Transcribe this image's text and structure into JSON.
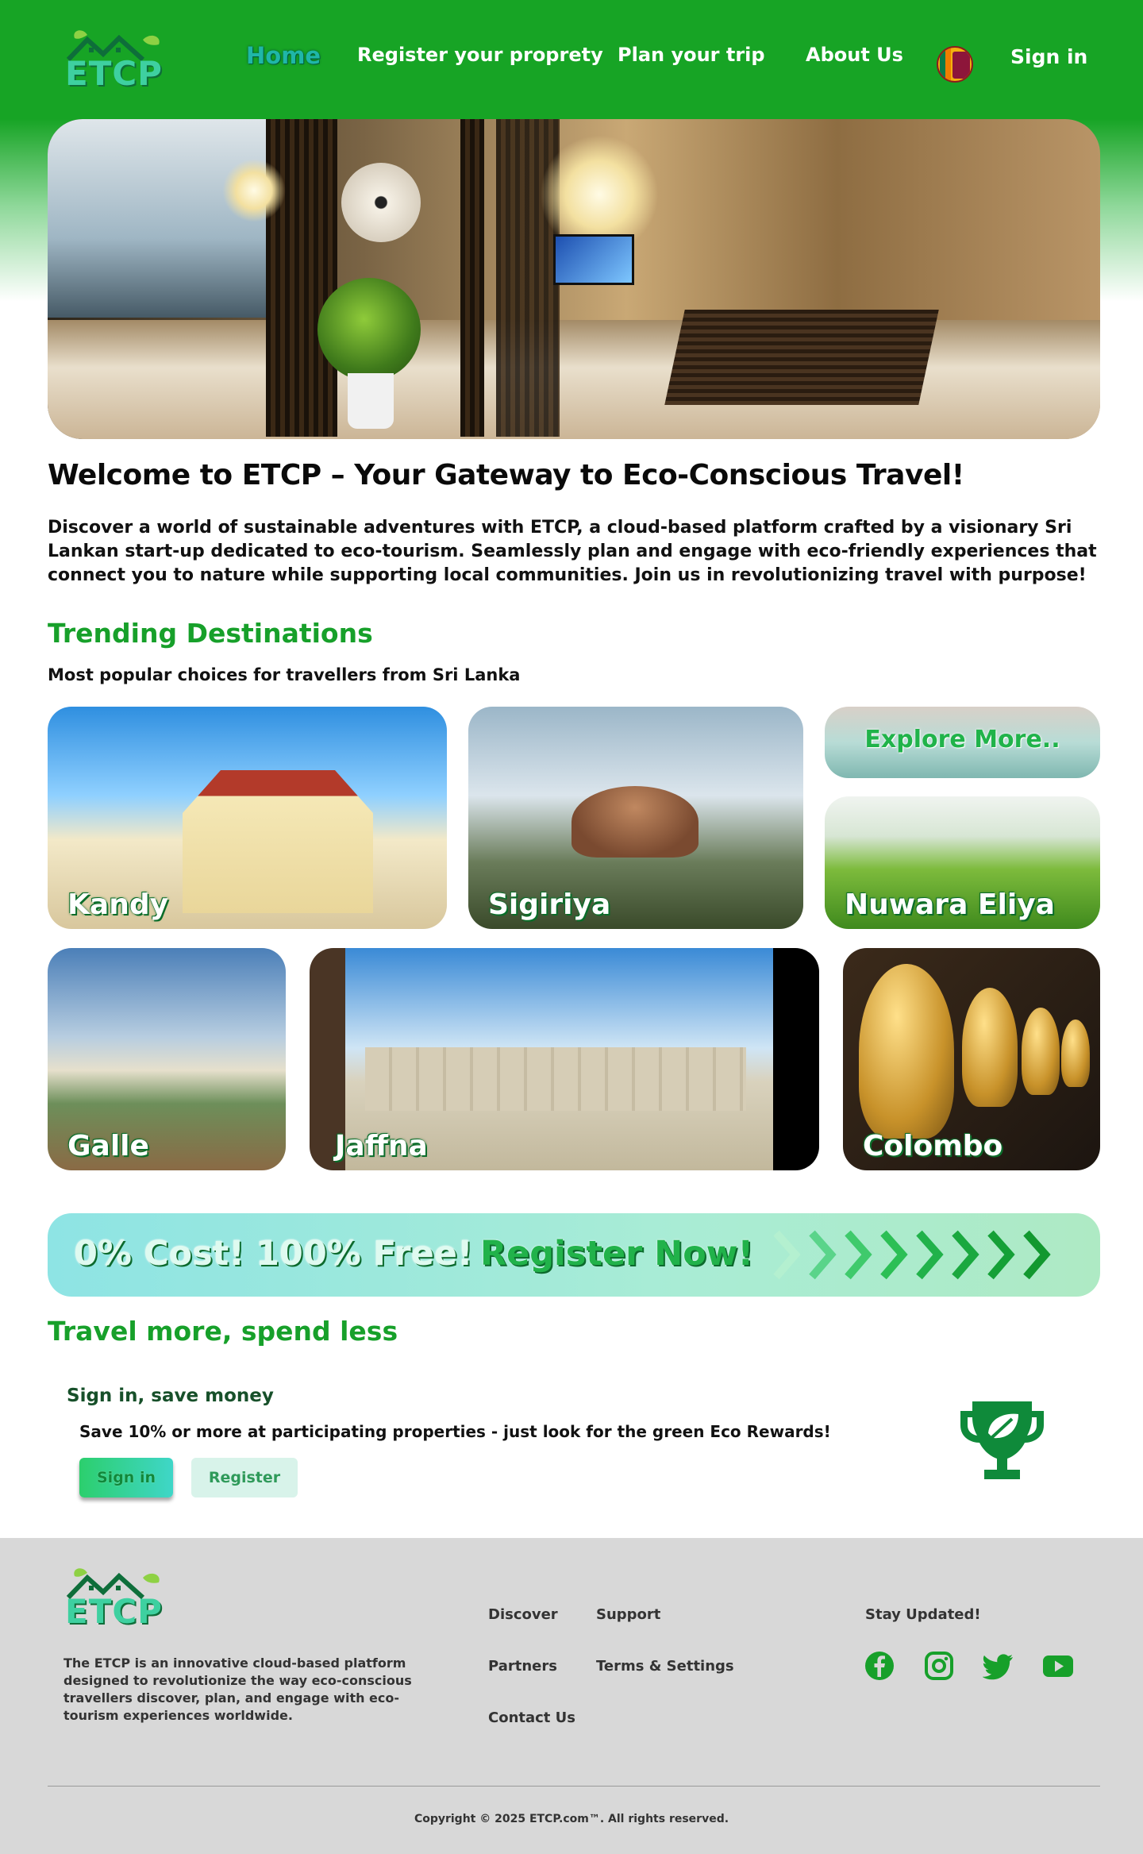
{
  "header": {
    "logo_text": "ETCP",
    "nav": {
      "home": "Home",
      "register_property": "Register your proprety",
      "plan_trip": "Plan your trip",
      "about": "About Us",
      "sign_in": "Sign in"
    },
    "flag_icon": "sri-lanka-flag-icon"
  },
  "hero": {
    "image": "hotel-lobby-image"
  },
  "welcome": {
    "title": "Welcome to ETCP – Your Gateway to Eco-Conscious Travel!",
    "intro": "Discover a world of sustainable adventures with ETCP, a cloud-based platform crafted by a visionary Sri Lankan start-up dedicated to eco-tourism. Seamlessly plan and engage with eco-friendly experiences that connect you to nature while supporting local communities. Join us in revolutionizing travel with purpose!"
  },
  "trending": {
    "title": "Trending Destinations",
    "subtitle": "Most popular choices for travellers from Sri Lanka",
    "destinations": [
      "Kandy",
      "Sigiriya",
      "Nuwara Eliya",
      "Galle",
      "Jaffna",
      "Colombo"
    ],
    "explore": "Explore More.."
  },
  "banner": {
    "cost": "0% Cost!",
    "free": "100% Free!",
    "register": "Register Now!"
  },
  "rewards": {
    "title": "Travel more, spend less",
    "sign_title": "Sign in, save money",
    "sign_sub": "Save 10% or more at participating properties - just look for the green Eco Rewards!",
    "sign_button": "Sign in",
    "register_button": "Register",
    "icon": "trophy-leaf-icon"
  },
  "footer": {
    "logo_text": "ETCP",
    "description": "The ETCP is an innovative cloud-based platform designed to revolutionize the way eco-conscious travellers discover, plan, and engage with eco-tourism experiences worldwide.",
    "links": {
      "discover": "Discover",
      "support": "Support",
      "partners": "Partners",
      "terms": "Terms & Settings",
      "contact": "Contact Us"
    },
    "stay": "Stay Updated!",
    "social": [
      "facebook-icon",
      "instagram-icon",
      "twitter-icon",
      "youtube-icon"
    ],
    "copyright": "Copyright © 2025 ETCP.com™. All rights reserved."
  },
  "colors": {
    "brand_green": "#17a425",
    "accent_teal": "#3fd6c8",
    "footer_bg": "#d8d8d8"
  }
}
